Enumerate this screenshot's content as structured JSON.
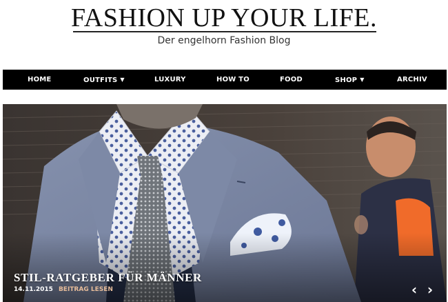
{
  "header": {
    "logo_text": "FASHION UP YOUR LIFE.",
    "tagline": "Der engelhorn Fashion Blog"
  },
  "nav": {
    "items": [
      {
        "label": "HOME",
        "has_dropdown": false
      },
      {
        "label": "OUTFITS",
        "has_dropdown": true
      },
      {
        "label": "LUXURY",
        "has_dropdown": false
      },
      {
        "label": "HOW TO",
        "has_dropdown": false
      },
      {
        "label": "FOOD",
        "has_dropdown": false
      },
      {
        "label": "SHOP",
        "has_dropdown": true
      },
      {
        "label": "ARCHIV",
        "has_dropdown": false
      }
    ],
    "dropdown_icon": "chevron-down-icon"
  },
  "hero": {
    "title": "STIL-RATGEBER FÜR MÄNNER",
    "date": "14.11.2015",
    "read_more": "BEITRAG LESEN",
    "prev_icon": "chevron-left-icon",
    "next_icon": "chevron-right-icon",
    "prev_glyph": "‹",
    "next_glyph": "›"
  },
  "colors": {
    "nav_background": "#000000",
    "nav_text": "#ffffff",
    "read_more_accent": "#e6bc9a"
  }
}
